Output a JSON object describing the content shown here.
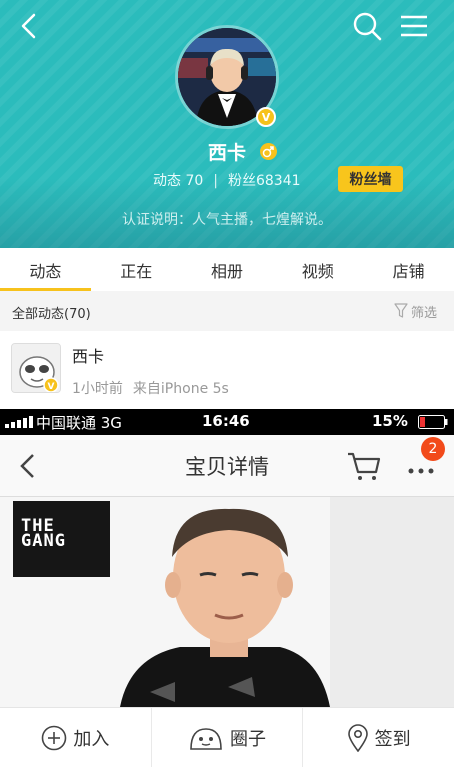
{
  "header": {
    "name": "西卡",
    "verified_badge": "V",
    "stats": {
      "posts_label": "动态 70",
      "fans_label": "粉丝68341"
    },
    "fans_wall_label": "粉丝墙",
    "auth_text": "认证说明：人气主播，七煌解说。",
    "icons": {
      "back": "back-arrow-icon",
      "search": "search-icon",
      "menu": "menu-icon",
      "gender": "male-icon"
    }
  },
  "tabs": [
    {
      "label": "动态",
      "active": true
    },
    {
      "label": "正在",
      "active": false
    },
    {
      "label": "相册",
      "active": false
    },
    {
      "label": "视频",
      "active": false
    },
    {
      "label": "店铺",
      "active": false
    }
  ],
  "filter": {
    "title": "全部动态(70)",
    "button_label": "筛选"
  },
  "post": {
    "author": "西卡",
    "time": "1小时前",
    "source": "来自iPhone 5s",
    "image": {
      "status_carrier": "中国联通 3G",
      "status_time": "16:46",
      "status_battery": "15%",
      "nav_title": "宝贝详情",
      "cart_badge": "2",
      "brand_logo_text": "THE GANG"
    }
  },
  "bottom_bar": [
    {
      "label": "加入",
      "icon": "plus-circle-icon"
    },
    {
      "label": "圈子",
      "icon": "circle-group-icon"
    },
    {
      "label": "签到",
      "icon": "location-pin-icon"
    }
  ],
  "colors": {
    "header_bg": "#2bbcbc",
    "accent_yellow": "#f7c21c",
    "cart_badge": "#f24a1a"
  }
}
